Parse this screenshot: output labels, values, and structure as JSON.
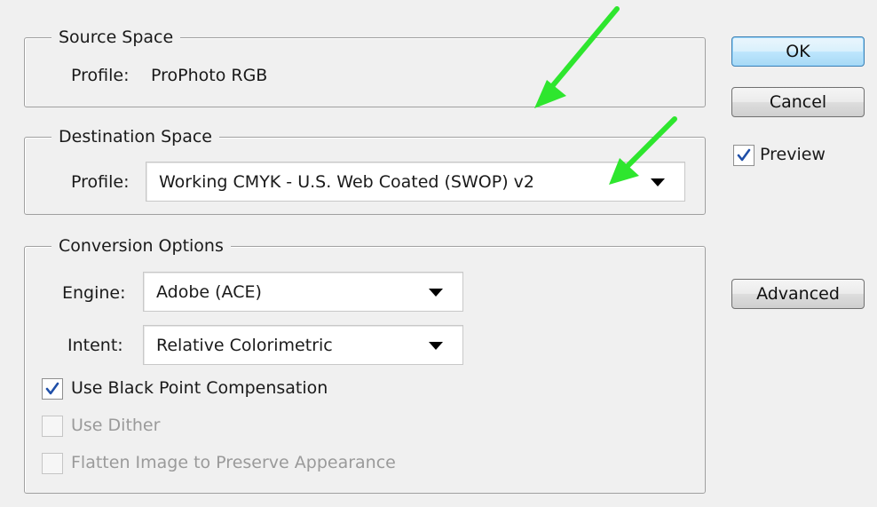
{
  "source_space": {
    "legend": "Source Space",
    "profile_label": "Profile:",
    "profile_value": "ProPhoto RGB"
  },
  "destination_space": {
    "legend": "Destination Space",
    "profile_label": "Profile:",
    "profile_value": "Working CMYK - U.S. Web Coated (SWOP) v2"
  },
  "conversion_options": {
    "legend": "Conversion Options",
    "engine_label": "Engine:",
    "engine_value": "Adobe (ACE)",
    "intent_label": "Intent:",
    "intent_value": "Relative Colorimetric",
    "black_point": {
      "label": "Use Black Point Compensation",
      "checked": true,
      "enabled": true
    },
    "dither": {
      "label": "Use Dither",
      "checked": false,
      "enabled": false
    },
    "flatten": {
      "label": "Flatten Image to Preserve Appearance",
      "checked": false,
      "enabled": false
    }
  },
  "buttons": {
    "ok": "OK",
    "cancel": "Cancel",
    "advanced": "Advanced"
  },
  "preview": {
    "label": "Preview",
    "checked": true
  },
  "colors": {
    "annotation_arrow": "#2ee62e",
    "check_mark": "#1f4fa8"
  }
}
